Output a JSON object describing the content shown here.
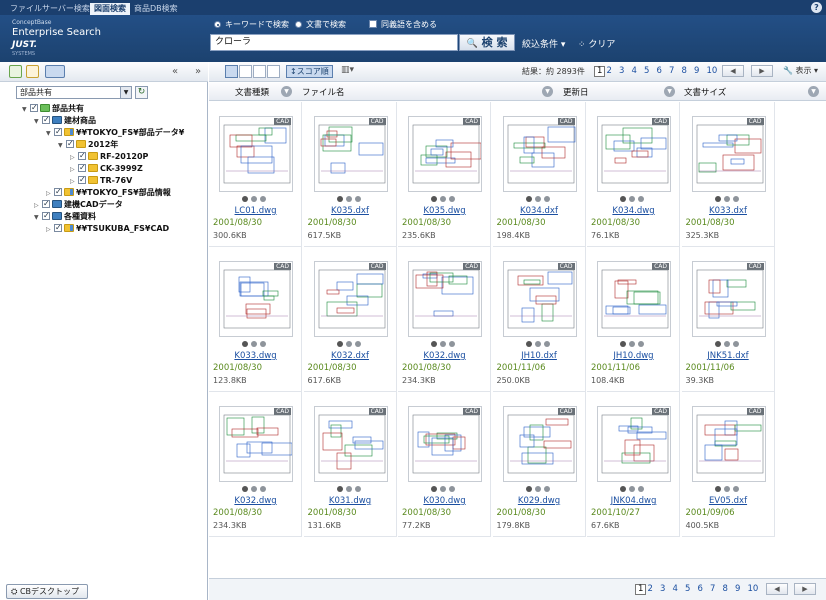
{
  "tabs": [
    "ファイルサーバー検索",
    "図面検索",
    "商品DB検索"
  ],
  "help_icon": "?",
  "logo": {
    "line1": "ConceptBase",
    "line2": "Enterprise Search",
    "line3": "JUST.",
    "line4": "SYSTEMS"
  },
  "search": {
    "radio_keyword": "キーワードで検索",
    "radio_text": "文書で検索",
    "synonym": "同義語を含める",
    "query": "クローラ",
    "button": "検 索",
    "filter": "絞込条件 ▾",
    "clear": "クリア"
  },
  "left": {
    "scope": "部品共有",
    "collapse": "«",
    "expand": "»",
    "tree": [
      {
        "label": "部品共有",
        "icon": "green",
        "toggle": "▼"
      },
      {
        "label": "建材商品",
        "icon": "db",
        "toggle": "▼"
      },
      {
        "label": "¥¥TOKYO_FS¥部品データ¥",
        "icon": "share",
        "toggle": "▼"
      },
      {
        "label": "2012年",
        "icon": "folder",
        "toggle": "▼"
      },
      {
        "label": "RF-20120P",
        "icon": "folder",
        "toggle": "▷"
      },
      {
        "label": "CK-3999Z",
        "icon": "folder",
        "toggle": "▷"
      },
      {
        "label": "TR-76V",
        "icon": "folder",
        "toggle": "▷"
      },
      {
        "label": "¥¥TOKYO_FS¥部品情報",
        "icon": "share",
        "toggle": "▷"
      },
      {
        "label": "建機CADデータ",
        "icon": "db",
        "toggle": "▷"
      },
      {
        "label": "各種資料",
        "icon": "db",
        "toggle": "▼"
      },
      {
        "label": "¥¥TSUKUBA_FS¥CAD",
        "icon": "share",
        "toggle": "▷"
      }
    ],
    "desktop_button": "CBデスクトップ"
  },
  "toolbar": {
    "sort": "↕スコア順",
    "chart": "▾",
    "results": "結果：約 2893件",
    "pages": [
      "1",
      "2",
      "3",
      "4",
      "5",
      "6",
      "7",
      "8",
      "9",
      "10"
    ],
    "prev": "◀",
    "next": "▶",
    "display": "表示 ▾"
  },
  "columns": [
    "文書種類",
    "ファイル名",
    "更新日",
    "文書サイズ"
  ],
  "cad_badge": "CAD",
  "files": [
    {
      "name": "LC01.dwg",
      "date": "2001/08/30",
      "size": "300.6KB"
    },
    {
      "name": "K035.dxf",
      "date": "2001/08/30",
      "size": "617.5KB"
    },
    {
      "name": "K035.dwg",
      "date": "2001/08/30",
      "size": "235.6KB"
    },
    {
      "name": "K034.dxf",
      "date": "2001/08/30",
      "size": "198.4KB"
    },
    {
      "name": "K034.dwg",
      "date": "2001/08/30",
      "size": "76.1KB"
    },
    {
      "name": "K033.dxf",
      "date": "2001/08/30",
      "size": "325.3KB"
    },
    {
      "name": "K033.dwg",
      "date": "2001/08/30",
      "size": "123.8KB"
    },
    {
      "name": "K032.dxf",
      "date": "2001/08/30",
      "size": "617.6KB"
    },
    {
      "name": "K032.dwg",
      "date": "2001/08/30",
      "size": "234.3KB"
    },
    {
      "name": "JH10.dxf",
      "date": "2001/11/06",
      "size": "250.0KB"
    },
    {
      "name": "JH10.dwg",
      "date": "2001/11/06",
      "size": "108.4KB"
    },
    {
      "name": "JNK51.dxf",
      "date": "2001/11/06",
      "size": "39.3KB"
    },
    {
      "name": "K032.dwg",
      "date": "2001/08/30",
      "size": "234.3KB"
    },
    {
      "name": "K031.dwg",
      "date": "2001/08/30",
      "size": "131.6KB"
    },
    {
      "name": "K030.dwg",
      "date": "2001/08/30",
      "size": "77.2KB"
    },
    {
      "name": "K029.dwg",
      "date": "2001/08/30",
      "size": "179.8KB"
    },
    {
      "name": "JNK04.dwg",
      "date": "2001/10/27",
      "size": "67.6KB"
    },
    {
      "name": "EV05.dxf",
      "date": "2001/09/06",
      "size": "400.5KB"
    }
  ],
  "colors": {
    "header": "#1c426f",
    "link": "#1b4fa1",
    "date": "#5a8a1e"
  }
}
